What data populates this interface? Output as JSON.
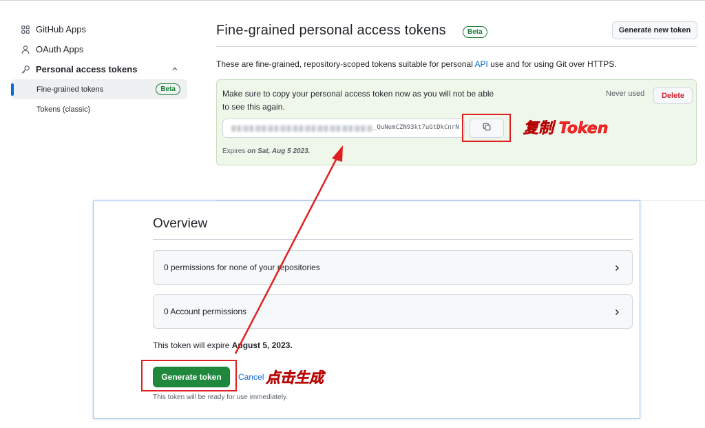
{
  "sidebar": {
    "items": [
      {
        "label": "GitHub Apps",
        "icon": "apps-grid-icon"
      },
      {
        "label": "OAuth Apps",
        "icon": "person-icon"
      },
      {
        "label": "Personal access tokens",
        "icon": "key-icon"
      }
    ],
    "subitems": [
      {
        "label": "Fine-grained tokens",
        "badge": "Beta",
        "active": true
      },
      {
        "label": "Tokens (classic)"
      }
    ]
  },
  "header": {
    "title": "Fine-grained personal access tokens",
    "badge": "Beta",
    "new_token_button": "Generate new token"
  },
  "description": {
    "before": "These are fine-grained, repository-scoped tokens suitable for personal ",
    "link": "API",
    "after": " use and for using Git over HTTPS."
  },
  "token_box": {
    "message": "Make sure to copy your personal access token now as you will not be able to see this again.",
    "status": "Never used",
    "delete_button": "Delete",
    "token_visible_suffix": "_QuNemCZN93kt7uGtDkCnrN",
    "expires_prefix": "Expires",
    "expires_date": "on Sat, Aug 5 2023."
  },
  "overview": {
    "title": "Overview",
    "permissions": [
      {
        "label": "0 permissions for none of your repositories"
      },
      {
        "label": "0 Account permissions"
      }
    ],
    "expire_text_prefix": "This token will expire ",
    "expire_date": "August 5, 2023.",
    "generate_button": "Generate token",
    "cancel_link": "Cancel",
    "ready_note": "This token will be ready for use immediately."
  },
  "annotations": {
    "copy_label": "复制 Token",
    "generate_label": "点击生成",
    "color": "#ff2424"
  }
}
